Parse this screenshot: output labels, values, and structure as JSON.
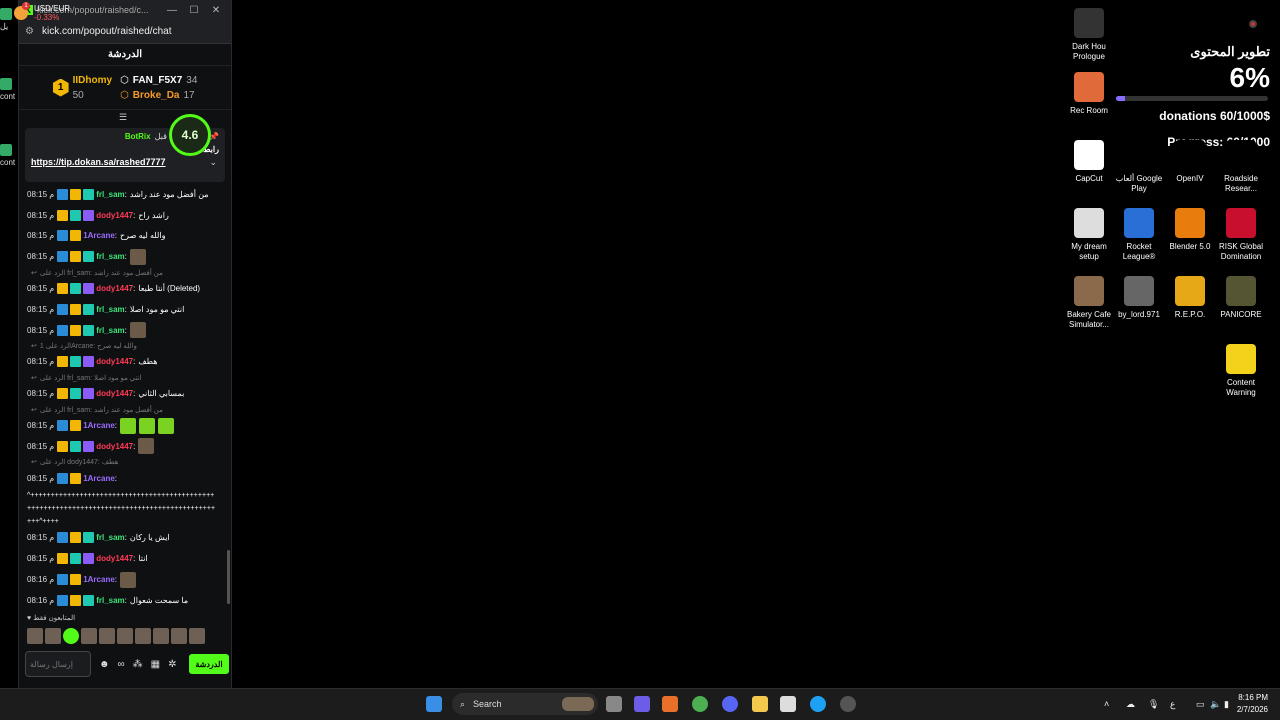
{
  "chat_window": {
    "title": "kick.com/popout/raished/c...",
    "url": "kick.com/popout/raished/chat",
    "header_title": "الدردشة",
    "leaderboard": {
      "first": {
        "rank": "1",
        "name": "IIDhomy",
        "count": "50"
      },
      "others": [
        {
          "name": "FAN_F5X7",
          "count": "34"
        },
        {
          "name": "Broke_Da",
          "count": "17"
        }
      ]
    },
    "rating": "4.6",
    "pinned": {
      "pinned_by_label": "أرسلت من قبل",
      "bot_name": "BotRix",
      "title": "رابط الدعم",
      "link": "https://tip.dokan.sa/rashed7777"
    },
    "messages": [
      {
        "time": "08:15 م",
        "user": "frl_sam",
        "user_color": "green",
        "badges": [
          "blue",
          "crown",
          "cyan"
        ],
        "text": "من أفضل مود عند راشد"
      },
      {
        "time": "08:15 م",
        "user": "dody1447",
        "user_color": "red",
        "badges": [
          "crown",
          "cyan",
          "purple"
        ],
        "text": "راشد راح"
      },
      {
        "time": "08:15 م",
        "user": "1Arcane",
        "user_color": "purple",
        "badges": [
          "blue",
          "crown"
        ],
        "text": "والله ليه صرح"
      },
      {
        "time": "08:15 م",
        "user": "frl_sam",
        "user_color": "green",
        "badges": [
          "blue",
          "crown",
          "cyan"
        ],
        "text": "",
        "emote": true
      },
      {
        "reply_to": "الرد على frl_sam: من أفضل مود عند راشد",
        "time": "08:15 م",
        "user": "dody1447",
        "user_color": "red",
        "badges": [
          "crown",
          "cyan",
          "purple"
        ],
        "text": "أنتا طبعا (Deleted)"
      },
      {
        "time": "08:15 م",
        "user": "frl_sam",
        "user_color": "green",
        "badges": [
          "blue",
          "crown",
          "cyan"
        ],
        "text": "انتي مو مود اصلا"
      },
      {
        "time": "08:15 م",
        "user": "frl_sam",
        "user_color": "green",
        "badges": [
          "blue",
          "crown",
          "cyan"
        ],
        "text": "",
        "emote": true
      },
      {
        "reply_to": "الرد على 1Arcane: والله ليه صرح",
        "time": "08:15 م",
        "user": "dody1447",
        "user_color": "red",
        "badges": [
          "crown",
          "cyan",
          "purple"
        ],
        "text": "هطف"
      },
      {
        "reply_to": "الرد على frl_sam: انتي مو مود اصلا",
        "time": "08:15 م",
        "user": "dody1447",
        "user_color": "red",
        "badges": [
          "crown",
          "cyan",
          "purple"
        ],
        "text": "بمسابي الثاني"
      },
      {
        "reply_to": "الرد على frl_sam: من أفضل مود عند راشد",
        "time": "08:15 م",
        "user": "1Arcane",
        "user_color": "purple",
        "badges": [
          "blue",
          "crown"
        ],
        "text": "",
        "emote_green": 3
      },
      {
        "time": "08:15 م",
        "user": "dody1447",
        "user_color": "red",
        "badges": [
          "crown",
          "cyan",
          "purple"
        ],
        "text": "",
        "emote": true
      },
      {
        "reply_to": "الرد على dody1447: هطف",
        "time": "08:15 م",
        "user": "1Arcane",
        "user_color": "purple",
        "badges": [
          "blue",
          "crown"
        ],
        "text": ""
      }
    ],
    "long_text": "^++++++++++++++++++++++++++++++++++++++++++++++++++++++++++++++++++++++++++++++++++++++++++++++^++++",
    "messages_after": [
      {
        "time": "08:15 م",
        "user": "frl_sam",
        "user_color": "green",
        "badges": [
          "blue",
          "crown",
          "cyan"
        ],
        "text": "ايش يا ركان"
      },
      {
        "time": "08:15 م",
        "user": "dody1447",
        "user_color": "red",
        "badges": [
          "crown",
          "cyan",
          "purple"
        ],
        "text": "انتا"
      },
      {
        "time": "08:16 م",
        "user": "1Arcane",
        "user_color": "purple",
        "badges": [
          "blue",
          "crown"
        ],
        "text": "",
        "emote": true
      },
      {
        "time": "08:16 م",
        "user": "frl_sam",
        "user_color": "green",
        "badges": [
          "blue",
          "crown",
          "cyan"
        ],
        "text": "ما سمحت شعوال"
      }
    ],
    "subs_label": "المتابعون فقط",
    "input_placeholder": "إرسال رسالة",
    "send_label": "الدردشة"
  },
  "goal": {
    "title": "تطوير المحتوى",
    "percent_text": "6%",
    "progress_fraction": 0.06,
    "donations": "donations 60/1000$",
    "progress": "Progress: 60/1000"
  },
  "desktop_icons": [
    {
      "label": "Dark Hou Prologue",
      "color": "#333"
    },
    {
      "label": "Rec Room",
      "color": "#e06a3a"
    },
    {
      "label": "CapCut",
      "color": "#fff"
    },
    {
      "label": "ألعاب Google Play",
      "color": "#000"
    },
    {
      "label": "OpenIV",
      "color": "#000"
    },
    {
      "label": "Roadside Resear...",
      "color": "#000"
    },
    {
      "label": "My dream setup",
      "color": "#ddd"
    },
    {
      "label": "Rocket League®",
      "color": "#2a6fd6"
    },
    {
      "label": "Blender 5.0",
      "color": "#e87d0d"
    },
    {
      "label": "RISK Global Domination",
      "color": "#c8102e"
    },
    {
      "label": "Bakery Cafe Simulator...",
      "color": "#8a6a4a"
    },
    {
      "label": "by_lord.971",
      "color": "#666"
    },
    {
      "label": "R.E.P.O.",
      "color": "#e6a817"
    },
    {
      "label": "PANICORE",
      "color": "#553"
    },
    {
      "label": "Content Warning",
      "color": "#f2d21a"
    }
  ],
  "edge_labels": [
    "يل",
    "cont",
    "cont"
  ],
  "taskbar": {
    "ticker_symbol": "USD/EUR",
    "ticker_value": "-0.33%",
    "ticker_badge": "1",
    "search_placeholder": "Search",
    "clock_time": "8:16 PM",
    "clock_date": "2/7/2026",
    "lang": "ع"
  }
}
